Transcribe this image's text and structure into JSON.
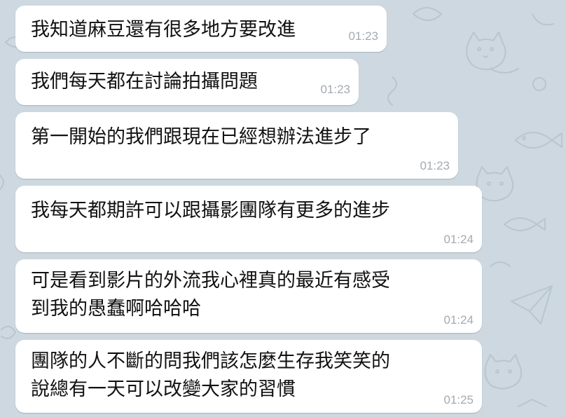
{
  "chat": {
    "messages": [
      {
        "text": "我知道麻豆還有很多地方要改進",
        "time": "01:23"
      },
      {
        "text": "我們每天都在討論拍攝問題",
        "time": "01:23"
      },
      {
        "text": "第一開始的我們跟現在已經想辦法進步了",
        "time": "01:23"
      },
      {
        "text": "我每天都期許可以跟攝影團隊有更多的進步",
        "time": "01:24"
      },
      {
        "text": "可是看到影片的外流我心裡真的最近有感受",
        "text2": "到我的愚蠢啊哈哈哈",
        "time": "01:24"
      },
      {
        "text": "團隊的人不斷的問我們該怎麼生存我笑笑的",
        "text2": "說總有一天可以改變大家的習慣",
        "time": "01:25"
      }
    ]
  },
  "colors": {
    "wallpaper": "#cdd8e0",
    "bubble": "#ffffff",
    "text": "#111111",
    "timestamp": "#a3abb2"
  },
  "icons": [
    "cat-doodle-icon",
    "fish-doodle-icon",
    "paper-plane-doodle-icon"
  ]
}
